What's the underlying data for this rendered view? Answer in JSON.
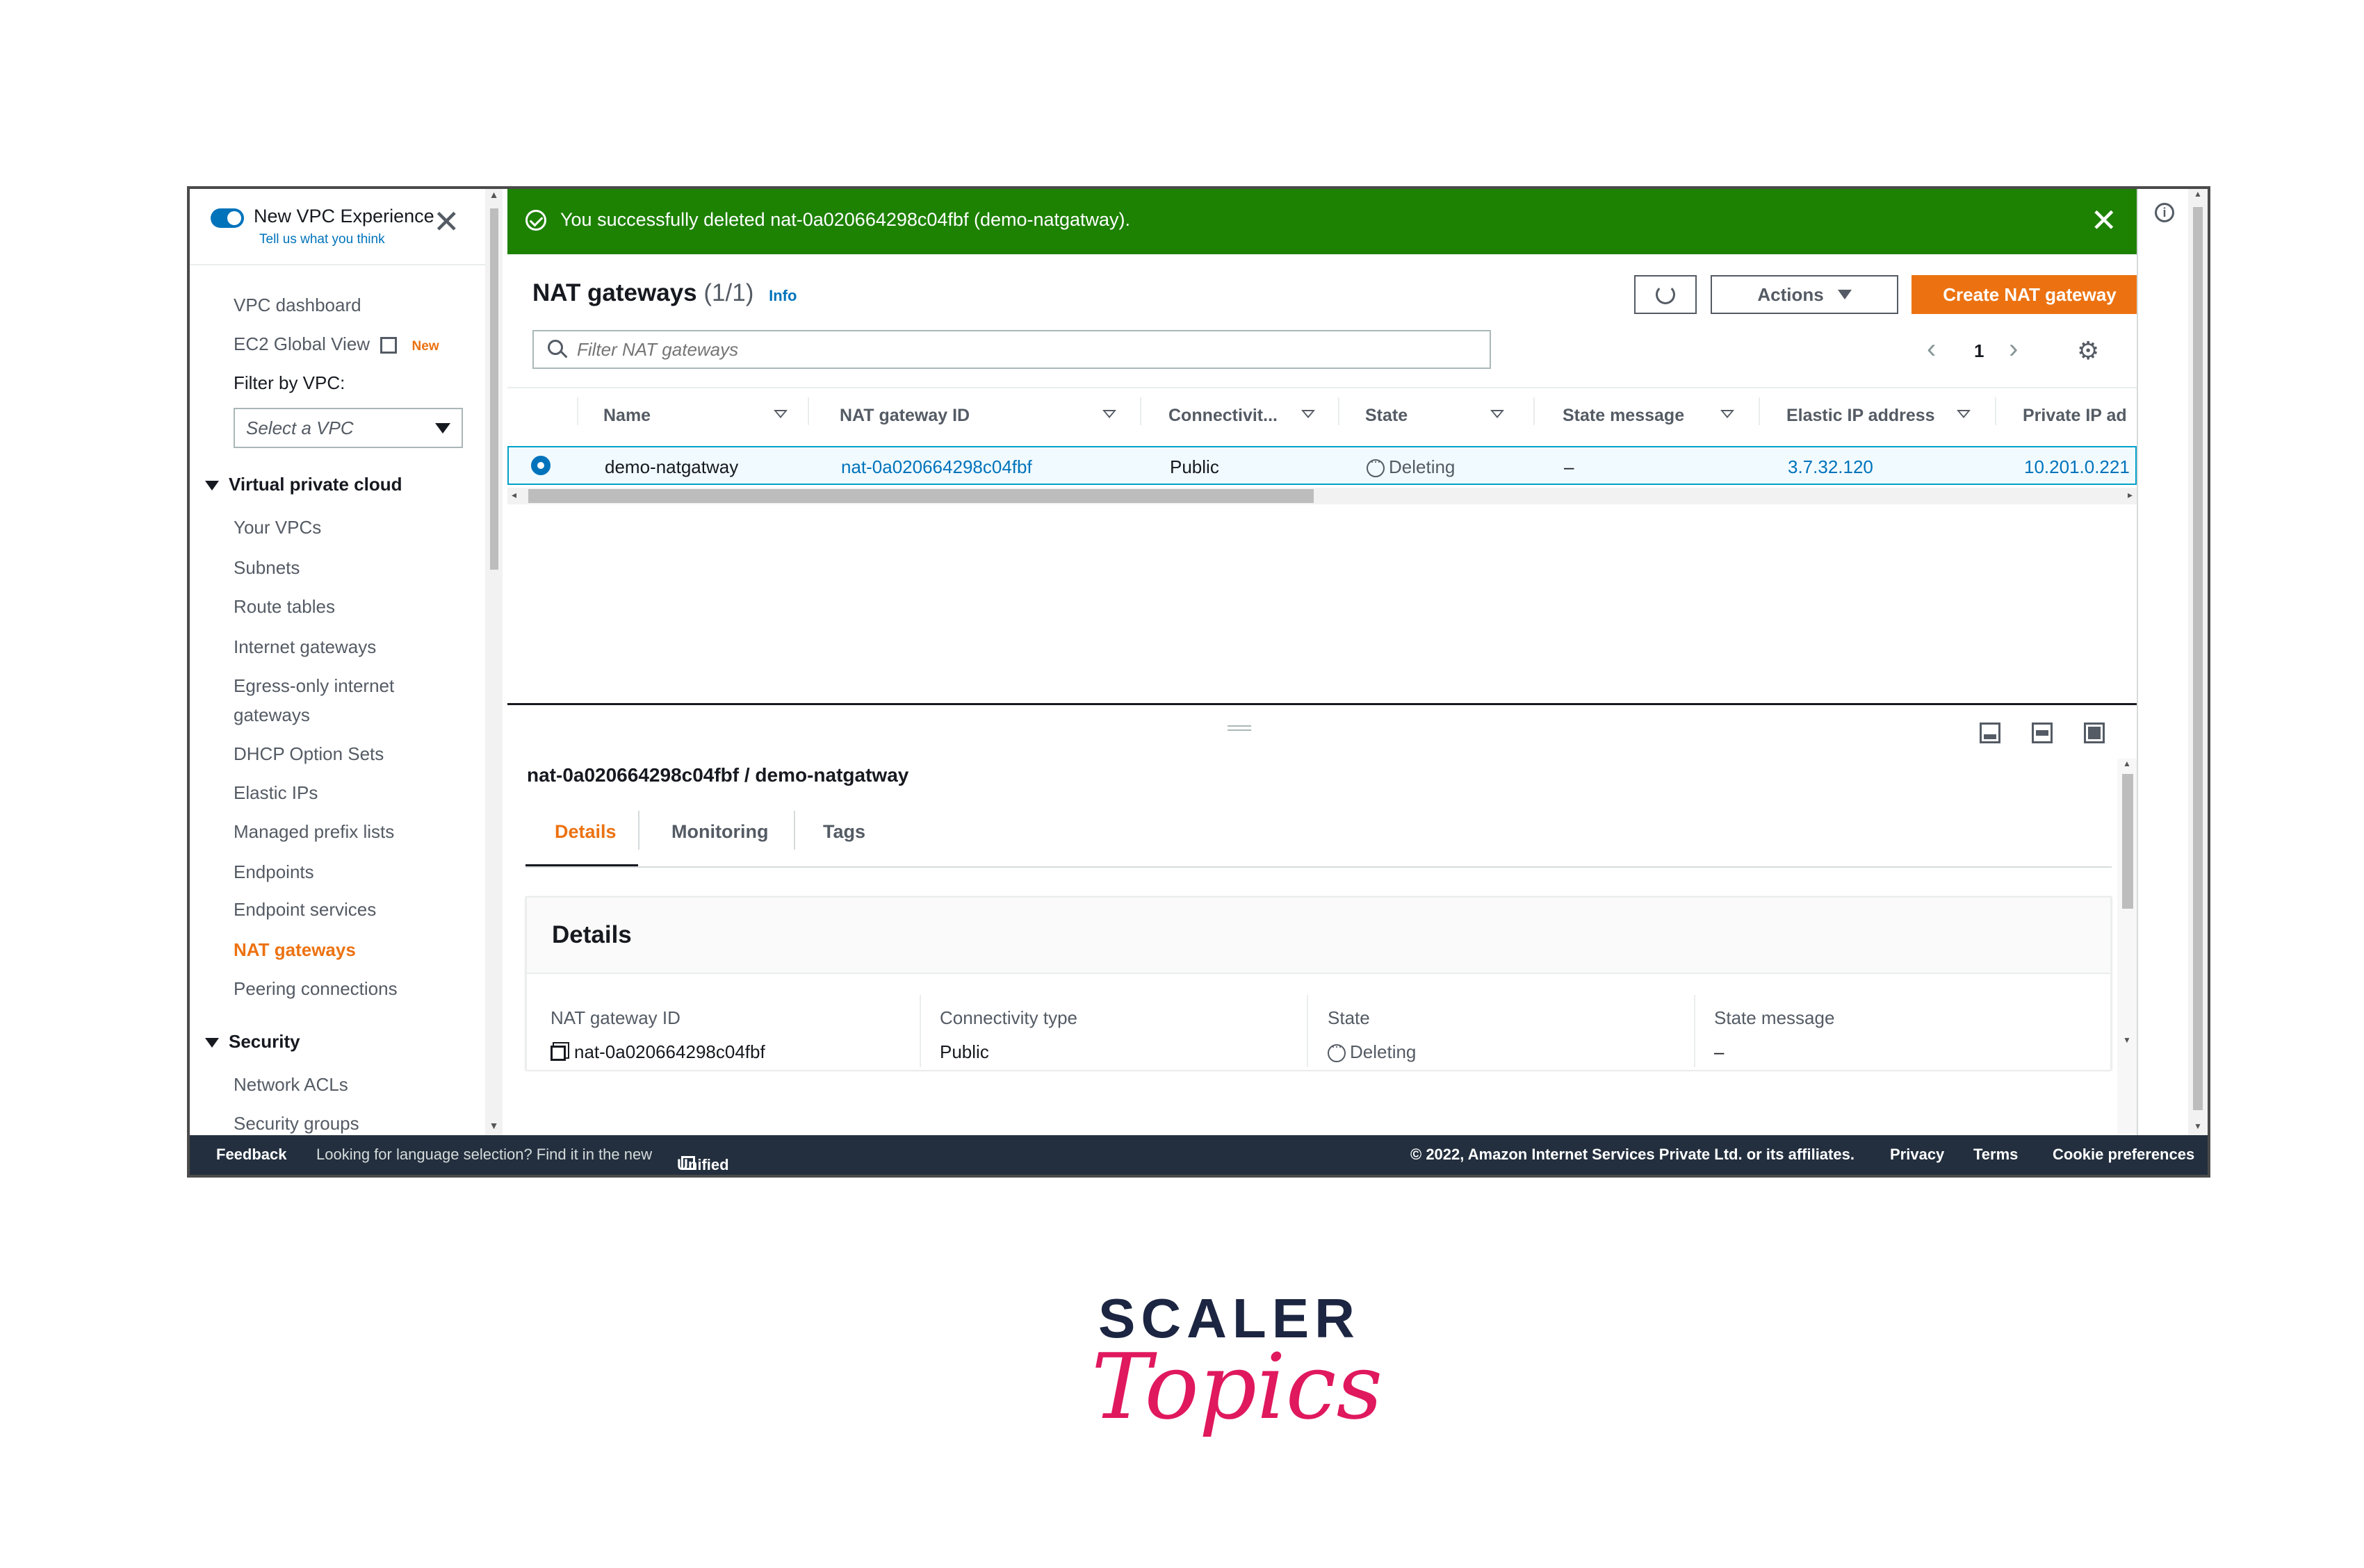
{
  "sidebar": {
    "experience_label": "New VPC Experience",
    "feedback_link": "Tell us what you think",
    "items_top": [
      "VPC dashboard",
      "EC2 Global View"
    ],
    "new_badge": "New",
    "filter_label": "Filter by VPC:",
    "filter_placeholder": "Select a VPC",
    "section_vpc": "Virtual private cloud",
    "vpc_items": [
      "Your VPCs",
      "Subnets",
      "Route tables",
      "Internet gateways",
      "Egress-only internet",
      "gateways",
      "DHCP Option Sets",
      "Elastic IPs",
      "Managed prefix lists",
      "Endpoints",
      "Endpoint services",
      "NAT gateways",
      "Peering connections"
    ],
    "section_security": "Security",
    "security_items": [
      "Network ACLs",
      "Security groups"
    ]
  },
  "flash": {
    "message": "You successfully deleted nat-0a020664298c04fbf (demo-natgatway).",
    "color": "#1d8102"
  },
  "header": {
    "title": "NAT gateways",
    "count": "(1/1)",
    "info": "Info",
    "actions": "Actions",
    "create": "Create NAT gateway",
    "filter_placeholder": "Filter NAT gateways",
    "page": "1"
  },
  "table": {
    "columns": [
      "Name",
      "NAT gateway ID",
      "Connectivit...",
      "State",
      "State message",
      "Elastic IP address",
      "Private IP ad"
    ],
    "row": {
      "name": "demo-natgatway",
      "id": "nat-0a020664298c04fbf",
      "connectivity": "Public",
      "state": "Deleting",
      "state_message": "–",
      "elastic_ip": "3.7.32.120",
      "private_ip": "10.201.0.221"
    }
  },
  "detail": {
    "heading": "nat-0a020664298c04fbf / demo-natgatway",
    "tabs": [
      "Details",
      "Monitoring",
      "Tags"
    ],
    "panel_title": "Details",
    "fields": [
      {
        "label": "NAT gateway ID",
        "value": "nat-0a020664298c04fbf"
      },
      {
        "label": "Connectivity type",
        "value": "Public"
      },
      {
        "label": "State",
        "value": "Deleting"
      },
      {
        "label": "State message",
        "value": "–"
      }
    ]
  },
  "footer": {
    "feedback": "Feedback",
    "language_text": "Looking for language selection? Find it in the new",
    "unified_settings": "Unified Settings",
    "copyright": "© 2022, Amazon Internet Services Private Ltd. or its affiliates.",
    "privacy": "Privacy",
    "terms": "Terms",
    "cookies": "Cookie preferences"
  },
  "brand": {
    "word1": "SCALER",
    "word2": "Topics",
    "pink": "#e0185d",
    "navy": "#1c2541"
  },
  "colors": {
    "accent_orange": "#ec7211",
    "link_blue": "#0073bb",
    "footer_bg": "#232f3e"
  }
}
